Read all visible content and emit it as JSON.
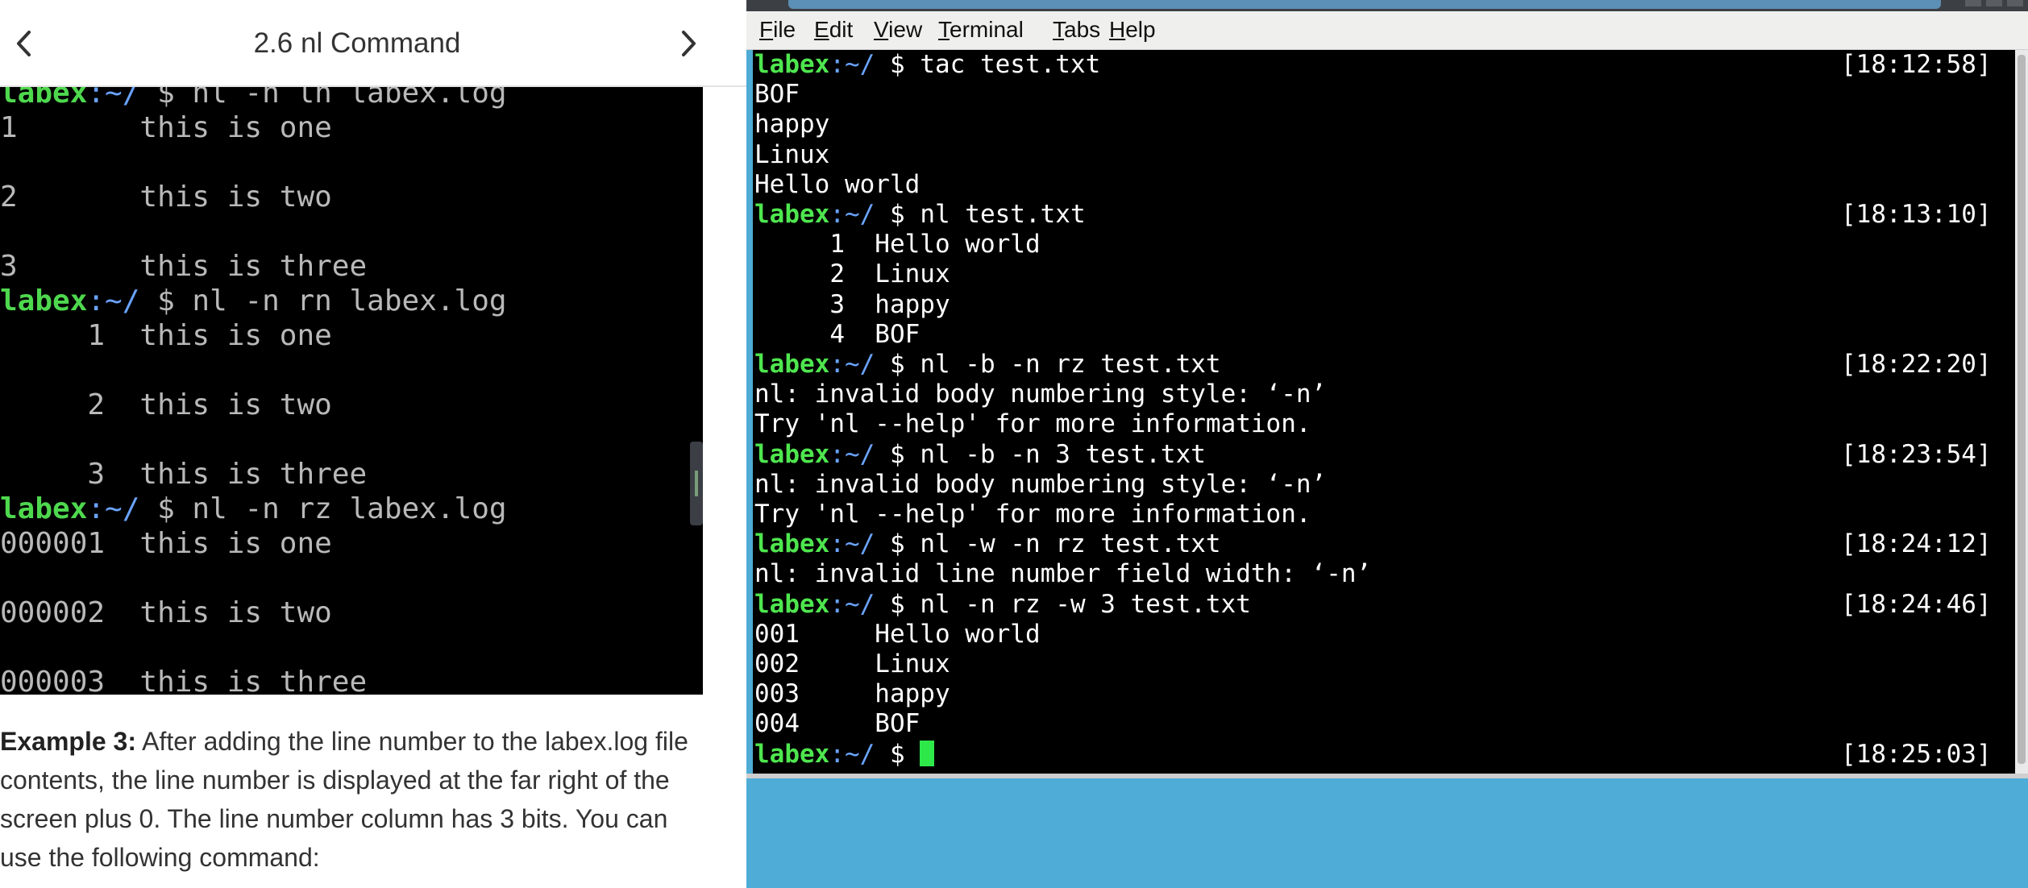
{
  "tutorial": {
    "lesson_title": "2.6 nl Command",
    "screenshot_lines": [
      {
        "user": "labex",
        "path": ":~/",
        "text": " $ nl -n ln labex.log"
      },
      {
        "text": "1       this is one"
      },
      {
        "text": ""
      },
      {
        "text": "2       this is two"
      },
      {
        "text": ""
      },
      {
        "text": "3       this is three"
      },
      {
        "user": "labex",
        "path": ":~/",
        "text": " $ nl -n rn labex.log"
      },
      {
        "text": "     1  this is one"
      },
      {
        "text": ""
      },
      {
        "text": "     2  this is two"
      },
      {
        "text": ""
      },
      {
        "text": "     3  this is three"
      },
      {
        "user": "labex",
        "path": ":~/",
        "text": " $ nl -n rz labex.log"
      },
      {
        "text": "000001  this is one"
      },
      {
        "text": ""
      },
      {
        "text": "000002  this is two"
      },
      {
        "text": ""
      },
      {
        "text": "000003  this is three"
      }
    ],
    "example_label": "Example 3:",
    "example_body": " After adding the line number to the labex.log file contents, the line number is displayed at the far right of the screen plus 0. The line number column has 3 bits. You can use the following command:"
  },
  "terminal": {
    "menu": [
      {
        "accel": "F",
        "rest": "ile"
      },
      {
        "accel": "E",
        "rest": "dit"
      },
      {
        "accel": "V",
        "rest": "iew"
      },
      {
        "accel": "T",
        "rest": "erminal"
      },
      {
        "accel": "T",
        "rest": "abs",
        "pre": ""
      },
      {
        "accel": "H",
        "rest": "elp"
      }
    ],
    "lines": [
      {
        "user": "labex",
        "path": ":~/",
        "text": " $ tac test.txt",
        "time": "[18:12:58]"
      },
      {
        "text": "BOF"
      },
      {
        "text": "happy"
      },
      {
        "text": "Linux"
      },
      {
        "text": "Hello world"
      },
      {
        "user": "labex",
        "path": ":~/",
        "text": " $ nl test.txt",
        "time": "[18:13:10]"
      },
      {
        "text": "     1  Hello world"
      },
      {
        "text": "     2  Linux"
      },
      {
        "text": "     3  happy"
      },
      {
        "text": "     4  BOF"
      },
      {
        "user": "labex",
        "path": ":~/",
        "text": " $ nl -b -n rz test.txt",
        "time": "[18:22:20]"
      },
      {
        "text": "nl: invalid body numbering style: ‘-n’"
      },
      {
        "text": "Try 'nl --help' for more information."
      },
      {
        "user": "labex",
        "path": ":~/",
        "text": " $ nl -b -n 3 test.txt",
        "time": "[18:23:54]"
      },
      {
        "text": "nl: invalid body numbering style: ‘-n’"
      },
      {
        "text": "Try 'nl --help' for more information."
      },
      {
        "user": "labex",
        "path": ":~/",
        "text": " $ nl -w -n rz test.txt",
        "time": "[18:24:12]"
      },
      {
        "text": "nl: invalid line number field width: ‘-n’"
      },
      {
        "user": "labex",
        "path": ":~/",
        "text": " $ nl -n rz -w 3 test.txt",
        "time": "[18:24:46]"
      },
      {
        "text": "001     Hello world"
      },
      {
        "text": "002     Linux"
      },
      {
        "text": "003     happy"
      },
      {
        "text": "004     BOF"
      },
      {
        "user": "labex",
        "path": ":~/",
        "text": " $ ",
        "time": "[18:25:03]",
        "cursor": true
      }
    ]
  },
  "icons": {
    "prev": "chevron-left-icon",
    "next": "chevron-right-icon"
  },
  "colors": {
    "desktop_background": "#4eacd6",
    "prompt_user": "#4ee64e",
    "prompt_path": "#6aa3ff",
    "terminal_background": "#000000",
    "cursor": "#2ee84a"
  }
}
